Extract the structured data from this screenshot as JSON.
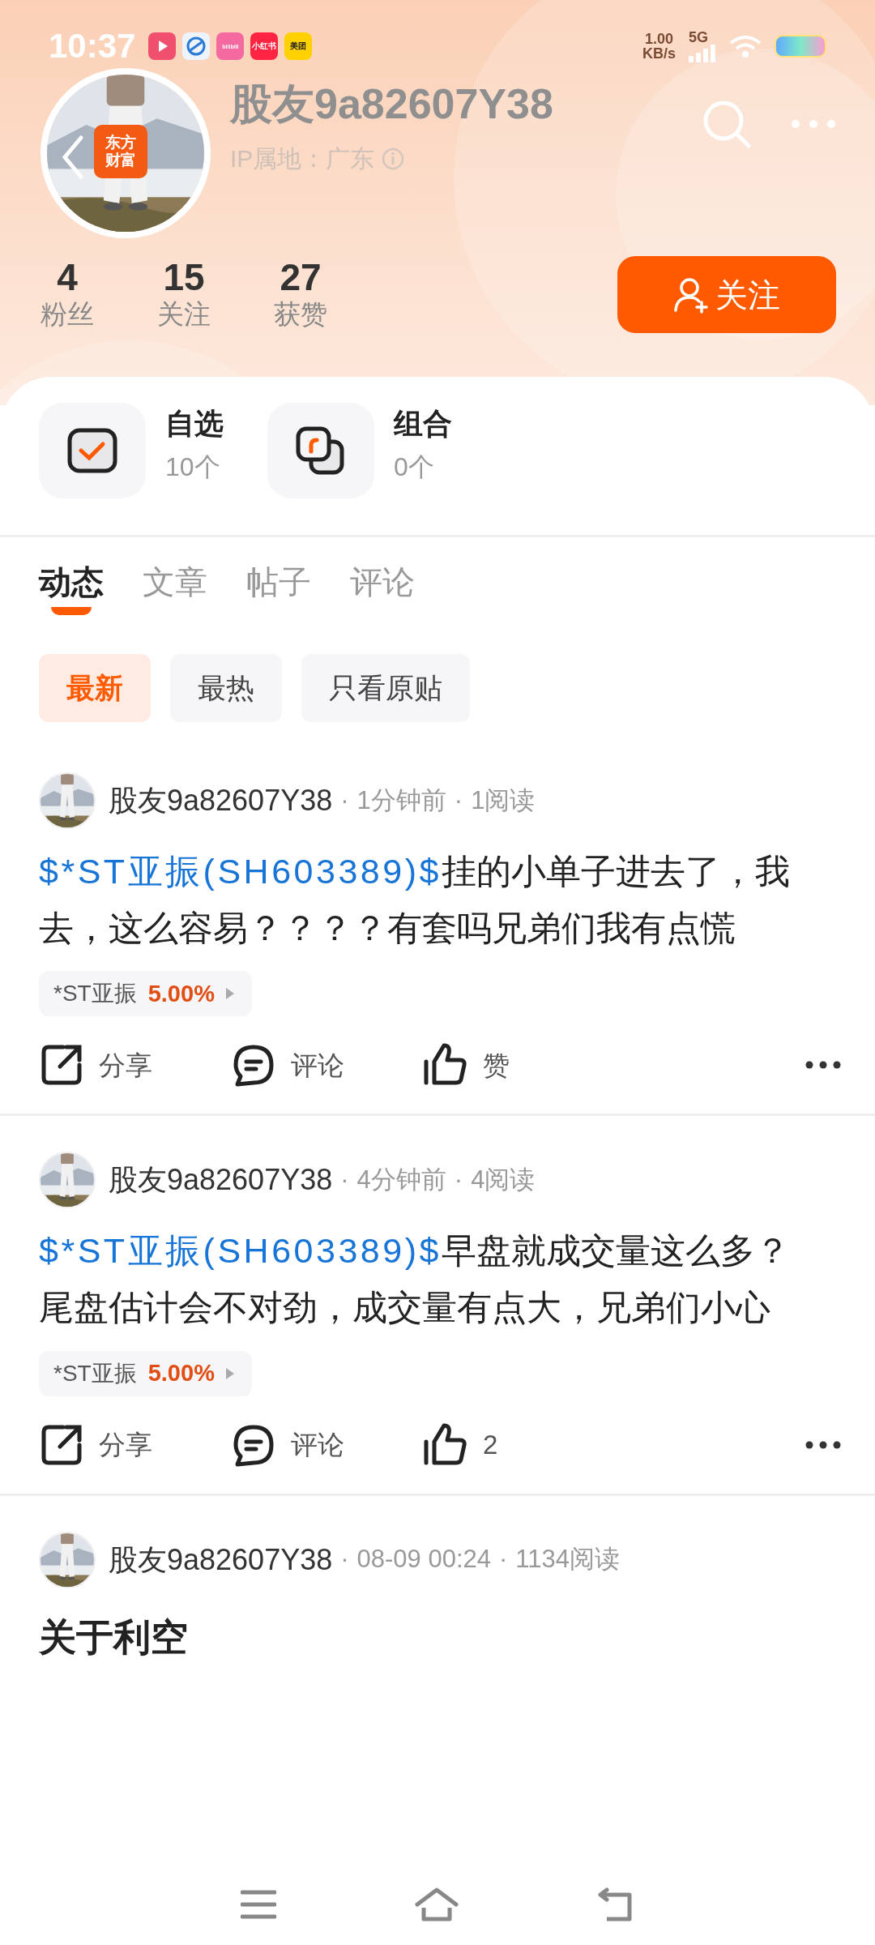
{
  "status_bar": {
    "time": "10:37",
    "apps": [
      "bilibili",
      "小红书",
      "美团"
    ],
    "net_speed": [
      "1.00",
      "KB/s"
    ],
    "network": "5G"
  },
  "header": {
    "username": "股友9a82607Y38",
    "ip_location": "IP属地：广东",
    "avatar_badge": [
      "东方",
      "财富"
    ]
  },
  "stats": [
    {
      "value": "4",
      "label": "粉丝"
    },
    {
      "value": "15",
      "label": "关注"
    },
    {
      "value": "27",
      "label": "获赞"
    }
  ],
  "follow_button": {
    "label": "关注"
  },
  "shortcuts": [
    {
      "kind": "watchlist",
      "title": "自选",
      "count": "10个"
    },
    {
      "kind": "portfolio",
      "title": "组合",
      "count": "0个"
    }
  ],
  "tabs": [
    {
      "label": "动态",
      "selected": true
    },
    {
      "label": "文章",
      "selected": false
    },
    {
      "label": "帖子",
      "selected": false
    },
    {
      "label": "评论",
      "selected": false
    }
  ],
  "filters": [
    {
      "label": "最新",
      "selected": true
    },
    {
      "label": "最热",
      "selected": false
    },
    {
      "label": "只看原贴",
      "selected": false
    }
  ],
  "posts": [
    {
      "kind": "status",
      "author": "股友9a82607Y38",
      "meta": [
        {
          "sep": "·",
          "text": "1分钟前"
        },
        {
          "sep": "·",
          "text": "1阅读"
        }
      ],
      "link": "$*ST亚振(SH603389)$",
      "text": "挂的小单子进去了，我去，这么容易？？？？有套吗兄弟们我有点慌",
      "stock": {
        "name": "*ST亚振",
        "change": "5.00%"
      },
      "actions": {
        "share": "分享",
        "comment": "评论",
        "like": "赞"
      }
    },
    {
      "kind": "status",
      "author": "股友9a82607Y38",
      "meta": [
        {
          "sep": "·",
          "text": "4分钟前"
        },
        {
          "sep": "·",
          "text": "4阅读"
        }
      ],
      "link": "$*ST亚振(SH603389)$",
      "text": "早盘就成交量这么多？尾盘估计会不对劲，成交量有点大，兄弟们小心",
      "stock": {
        "name": "*ST亚振",
        "change": "5.00%"
      },
      "actions": {
        "share": "分享",
        "comment": "评论",
        "like": "2"
      }
    },
    {
      "kind": "article",
      "author": "股友9a82607Y38",
      "meta": [
        {
          "sep": "·",
          "text": "08-09 00:24"
        },
        {
          "sep": "·",
          "text": "1134阅读"
        }
      ],
      "title": "关于利空"
    }
  ]
}
